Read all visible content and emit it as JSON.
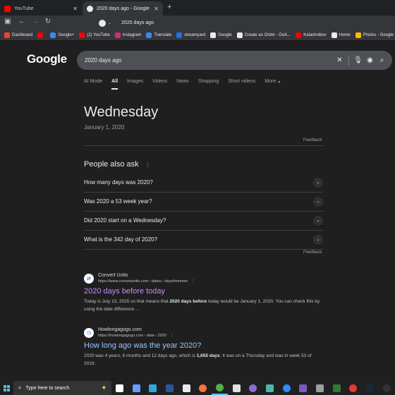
{
  "browser": {
    "tabs": [
      {
        "title": "YouTube",
        "icon": "youtube-icon"
      },
      {
        "title": "2020 days ago - Google Search",
        "icon": "google-icon"
      }
    ],
    "address": "2020 days ago",
    "bookmarks": [
      {
        "label": "Dashboard",
        "color": "#ea4335"
      },
      {
        "label": "",
        "color": "#ff0000"
      },
      {
        "label": "Google+",
        "color": "#4285f4"
      },
      {
        "label": "(2) YouTube",
        "color": "#ff0000"
      },
      {
        "label": "Instagram",
        "color": "#d62976"
      },
      {
        "label": "Translate",
        "color": "#4285f4"
      },
      {
        "label": "streamyard",
        "color": "#1a73e8"
      },
      {
        "label": "Google",
        "color": "#e8eaed"
      },
      {
        "label": "Create an Order - GoA...",
        "color": "#e8eaed"
      },
      {
        "label": "Kalashnikov",
        "color": "#ff0000"
      },
      {
        "label": "Home",
        "color": "#e8eaed"
      },
      {
        "label": "Photos - Google Phot",
        "color": "#fbbc04"
      }
    ]
  },
  "google": {
    "logo": "Google",
    "query": "2020 days ago",
    "nav_tabs": [
      "AI Mode",
      "All",
      "Images",
      "Videos",
      "News",
      "Shopping",
      "Short videos",
      "More"
    ],
    "active_tab": "All"
  },
  "answer": {
    "day": "Wednesday",
    "date": "January 1, 2020",
    "feedback": "Feedback"
  },
  "people_also_ask": {
    "title": "People also ask",
    "questions": [
      "How many days was 2020?",
      "Was 2020 a 53 week year?",
      "Did 2020 start on a Wednesday?",
      "What is the 342 day of 2020?"
    ],
    "feedback": "Feedback"
  },
  "results": [
    {
      "site": "Convert Units",
      "url": "https://www.convertunits.com › dates › daysfromnow",
      "title": "2020 days before today",
      "visited": true,
      "snippet_parts": [
        {
          "t": "Today is July 13, 2025 so that means that "
        },
        {
          "t": "2020 days before",
          "b": true
        },
        {
          "t": " today would be January 1, 2020. You can check this by using the date difference ..."
        }
      ]
    },
    {
      "site": "Howlongagogo.com",
      "url": "https://howlongagogo.com › date › 2020",
      "title": "How long ago was the year 2020?",
      "visited": false,
      "snippet_parts": [
        {
          "t": "2020 was 4 years, 6 months and 12 days ago, which is "
        },
        {
          "t": "1,655 days",
          "b": true
        },
        {
          "t": ". It was on a Thursday and was in week 53 of 2019."
        }
      ]
    }
  ],
  "taskbar": {
    "search_placeholder": "Type here to search",
    "apps": [
      {
        "name": "task-view",
        "color": "#ffffff"
      },
      {
        "name": "widgets",
        "color": "#6b9bff"
      },
      {
        "name": "edge",
        "color": "#2fa8e0"
      },
      {
        "name": "word",
        "color": "#2b579a"
      },
      {
        "name": "app-s",
        "color": "#e8eaed"
      },
      {
        "name": "firefox",
        "color": "#ff7139"
      },
      {
        "name": "chrome",
        "color": "#4caf50"
      },
      {
        "name": "app-d",
        "color": "#e0e0e0"
      },
      {
        "name": "screenshot",
        "color": "#8a6fd1"
      },
      {
        "name": "recycle",
        "color": "#4db6ac"
      },
      {
        "name": "zoom",
        "color": "#2d8cff"
      },
      {
        "name": "app-swap",
        "color": "#7e57c2"
      },
      {
        "name": "app-grey",
        "color": "#9e9e9e"
      },
      {
        "name": "app-green",
        "color": "#2e7d32"
      },
      {
        "name": "app-red",
        "color": "#e53935"
      },
      {
        "name": "steam",
        "color": "#1b2838"
      },
      {
        "name": "obs",
        "color": "#333333"
      }
    ]
  }
}
